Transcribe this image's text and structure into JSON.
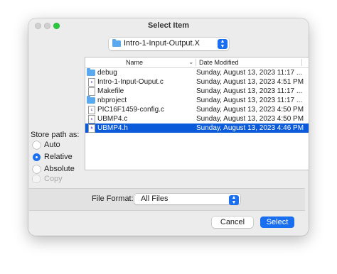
{
  "dialog": {
    "title": "Select Item"
  },
  "folder_popup": {
    "label": "Intro-1-Input-Output.X",
    "icon": "folder-icon"
  },
  "columns": {
    "name": "Name",
    "date_modified": "Date Modified",
    "sort_icon": "chevron-down-icon"
  },
  "files": [
    {
      "name": "debug",
      "date": "Sunday, August 13, 2023 11:17 ...",
      "icon": "folder-icon",
      "selected": false
    },
    {
      "name": "Intro-1-Input-Ouput.c",
      "date": "Sunday, August 13, 2023 4:51 PM",
      "icon": "c-file-icon",
      "selected": false
    },
    {
      "name": "Makefile",
      "date": "Sunday, August 13, 2023 11:17 ...",
      "icon": "file-icon",
      "selected": false
    },
    {
      "name": "nbproject",
      "date": "Sunday, August 13, 2023 11:17 ...",
      "icon": "folder-icon",
      "selected": false
    },
    {
      "name": "PIC16F1459-config.c",
      "date": "Sunday, August 13, 2023 4:50 PM",
      "icon": "c-file-icon",
      "selected": false
    },
    {
      "name": "UBMP4.c",
      "date": "Sunday, August 13, 2023 4:50 PM",
      "icon": "c-file-icon",
      "selected": false
    },
    {
      "name": "UBMP4.h",
      "date": "Sunday, August 13, 2023 4:46 PM",
      "icon": "h-file-icon",
      "selected": true
    }
  ],
  "store_path": {
    "label": "Store path as:",
    "options": [
      {
        "label": "Auto",
        "selected": false
      },
      {
        "label": "Relative",
        "selected": true
      },
      {
        "label": "Absolute",
        "selected": false
      }
    ],
    "copy_label": "Copy",
    "copy_enabled": false
  },
  "file_format": {
    "label": "File Format:",
    "value": "All Files"
  },
  "buttons": {
    "cancel": "Cancel",
    "select": "Select"
  },
  "colors": {
    "accent": "#1a6ff0",
    "selection": "#0b5ad9",
    "folder": "#5aa9ef"
  }
}
